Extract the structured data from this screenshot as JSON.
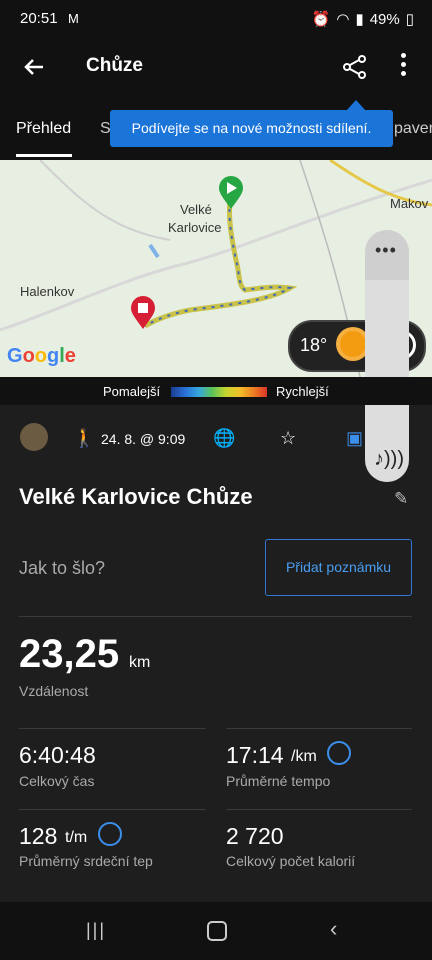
{
  "status_bar": {
    "time": "20:51",
    "battery": "49%"
  },
  "app_bar": {
    "title": "Chůze"
  },
  "tabs": {
    "active": "Přehled",
    "second_partial": "S",
    "third_partial": "paven"
  },
  "tooltip": {
    "text": "Podívejte se na nové možnosti sdílení."
  },
  "map": {
    "labels": [
      "Velké",
      "Karlovice",
      "Halenkov",
      "Makov"
    ],
    "google": "Google",
    "temperature": "18°"
  },
  "legend": {
    "slow": "Pomalejší",
    "fast": "Rychlejší"
  },
  "info": {
    "date": "24. 8. @ 9:09"
  },
  "activity": {
    "name": "Velké Karlovice Chůze"
  },
  "note": {
    "prompt": "Jak to šlo?",
    "button": "Přidat poznámku"
  },
  "distance": {
    "value": "23,25",
    "unit": "km",
    "label": "Vzdálenost"
  },
  "stats": {
    "total_time": {
      "value": "6:40:48",
      "label": "Celkový čas"
    },
    "avg_pace": {
      "value": "17:14",
      "unit": "/km",
      "label": "Průměrné tempo"
    },
    "avg_hr": {
      "value": "128",
      "unit": "t/m",
      "label": "Průměrný srdeční tep"
    },
    "calories": {
      "value": "2 720",
      "label": "Celkový počet kalorií"
    }
  },
  "colors": {
    "accent": "#1b74d8",
    "route_start": "#27a744",
    "route_end": "#d61f34"
  }
}
